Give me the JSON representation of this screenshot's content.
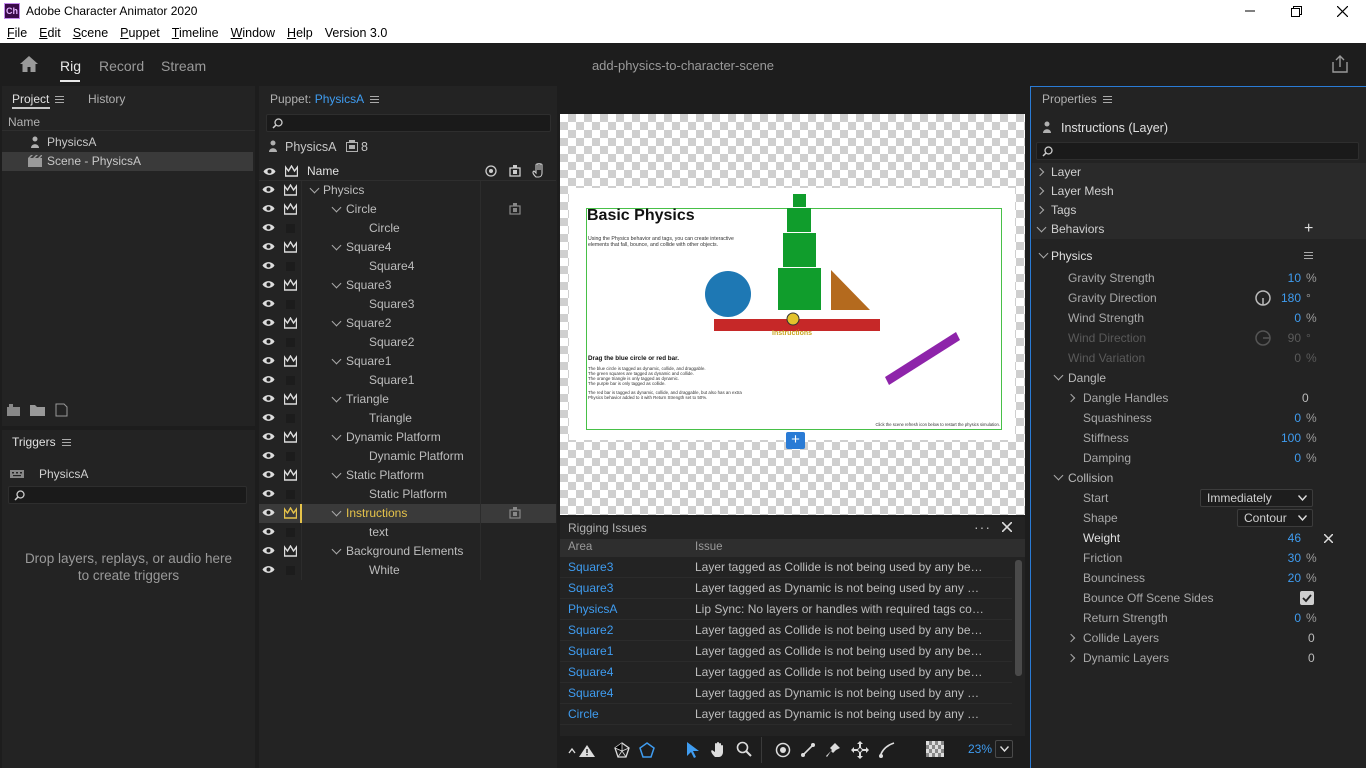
{
  "app": {
    "title": "Adobe Character Animator 2020",
    "logo": "Ch"
  },
  "menu": [
    "File",
    "Edit",
    "Scene",
    "Puppet",
    "Timeline",
    "Window",
    "Help",
    "Version 3.0"
  ],
  "menu_mnemonics": [
    "F",
    "E",
    "S",
    "P",
    "T",
    "W",
    "H",
    ""
  ],
  "workspace": {
    "tabs": [
      "Rig",
      "Record",
      "Stream"
    ],
    "active": "Rig",
    "document_title": "add-physics-to-character-scene"
  },
  "project": {
    "tabs": [
      "Project",
      "History"
    ],
    "column": "Name",
    "items": [
      "PhysicsA",
      "Scene - PhysicsA"
    ]
  },
  "triggers": {
    "title": "Triggers",
    "puppet": "PhysicsA",
    "empty_text_1": "Drop layers, replays, or audio here",
    "empty_text_2": "to create triggers"
  },
  "puppet_panel": {
    "title_prefix": "Puppet:",
    "title_name": "PhysicsA",
    "summary_name": "PhysicsA",
    "summary_count": "8",
    "column_name": "Name",
    "rows": [
      {
        "label": "Physics",
        "level": 0,
        "group": true,
        "crown": true
      },
      {
        "label": "Circle",
        "level": 1,
        "group": true,
        "crown": true,
        "lock": true
      },
      {
        "label": "Circle",
        "level": 2,
        "group": false,
        "crown": false
      },
      {
        "label": "Square4",
        "level": 1,
        "group": true,
        "crown": true
      },
      {
        "label": "Square4",
        "level": 2,
        "group": false,
        "crown": false
      },
      {
        "label": "Square3",
        "level": 1,
        "group": true,
        "crown": true
      },
      {
        "label": "Square3",
        "level": 2,
        "group": false,
        "crown": false
      },
      {
        "label": "Square2",
        "level": 1,
        "group": true,
        "crown": true
      },
      {
        "label": "Square2",
        "level": 2,
        "group": false,
        "crown": false
      },
      {
        "label": "Square1",
        "level": 1,
        "group": true,
        "crown": true
      },
      {
        "label": "Square1",
        "level": 2,
        "group": false,
        "crown": false
      },
      {
        "label": "Triangle",
        "level": 1,
        "group": true,
        "crown": true
      },
      {
        "label": "Triangle",
        "level": 2,
        "group": false,
        "crown": false
      },
      {
        "label": "Dynamic Platform",
        "level": 1,
        "group": true,
        "crown": true
      },
      {
        "label": "Dynamic Platform",
        "level": 2,
        "group": false,
        "crown": false
      },
      {
        "label": "Static Platform",
        "level": 1,
        "group": true,
        "crown": true
      },
      {
        "label": "Static Platform",
        "level": 2,
        "group": false,
        "crown": false
      },
      {
        "label": "Instructions",
        "level": 1,
        "group": true,
        "crown": true,
        "selected": true,
        "lock": true
      },
      {
        "label": "text",
        "level": 2,
        "group": false,
        "crown": false
      },
      {
        "label": "Background Elements",
        "level": 1,
        "group": true,
        "crown": true
      },
      {
        "label": "White",
        "level": 2,
        "group": false,
        "crown": false
      }
    ]
  },
  "scene": {
    "title": "Basic Physics",
    "intro": "Using the Physics behavior and tags, you can create interactive elements that fall, bounce, and collide with other objects.",
    "drag_heading": "Drag the blue circle or red bar.",
    "notes": [
      "The blue circle is tagged as dynamic, collide, and draggable.",
      "The green squares are tagged as dynamic and collide.",
      "The orange triangle is only tagged as dynamic.",
      "The purple bar is only tagged as collide."
    ],
    "note2": "The red bar is tagged as dynamic, collide, and draggable, but also has an extra Physics behavior added to it with Return Strength set to 50%.",
    "footer": "Click the scene refresh icon below to restart the physics simulation.",
    "handle_label": "Instructions"
  },
  "rigging_issues": {
    "title": "Rigging Issues",
    "columns": [
      "Area",
      "Issue"
    ],
    "rows": [
      {
        "area": "Square3",
        "issue": "Layer tagged as Collide is not being used by any behavior"
      },
      {
        "area": "Square3",
        "issue": "Layer tagged as Dynamic is not being used by any behavior"
      },
      {
        "area": "PhysicsA",
        "issue": "Lip Sync: No layers or handles with required tags could be found"
      },
      {
        "area": "Square2",
        "issue": "Layer tagged as Collide is not being used by any behavior"
      },
      {
        "area": "Square1",
        "issue": "Layer tagged as Collide is not being used by any behavior"
      },
      {
        "area": "Square4",
        "issue": "Layer tagged as Collide is not being used by any behavior"
      },
      {
        "area": "Square4",
        "issue": "Layer tagged as Dynamic is not being used by any behavior"
      },
      {
        "area": "Circle",
        "issue": "Layer tagged as Dynamic is not being used by any behavior"
      }
    ]
  },
  "toolbar": {
    "zoom": "23%"
  },
  "properties": {
    "title": "Properties",
    "layer_title": "Instructions (Layer)",
    "sections": [
      "Layer",
      "Layer Mesh",
      "Tags",
      "Behaviors"
    ],
    "physics_label": "Physics",
    "params": [
      {
        "label": "Gravity Strength",
        "value": "10",
        "unit": "%"
      },
      {
        "label": "Gravity Direction",
        "value": "180",
        "unit": "°"
      },
      {
        "label": "Wind Strength",
        "value": "0",
        "unit": "%"
      },
      {
        "label": "Wind Direction",
        "value": "90",
        "unit": "°",
        "disabled": true
      },
      {
        "label": "Wind Variation",
        "value": "0",
        "unit": "%",
        "disabled": true
      }
    ],
    "dangle_label": "Dangle",
    "dangle": [
      {
        "label": "Dangle Handles",
        "value": "0",
        "unit": ""
      },
      {
        "label": "Squashiness",
        "value": "0",
        "unit": "%"
      },
      {
        "label": "Stiffness",
        "value": "100",
        "unit": "%"
      },
      {
        "label": "Damping",
        "value": "0",
        "unit": "%"
      }
    ],
    "collision_label": "Collision",
    "start_label": "Start",
    "start_value": "Immediately",
    "shape_label": "Shape",
    "shape_value": "Contour",
    "weight_label": "Weight",
    "weight_value": "46",
    "friction_label": "Friction",
    "friction_value": "30",
    "friction_unit": "%",
    "bounciness_label": "Bounciness",
    "bounciness_value": "20",
    "bounciness_unit": "%",
    "bounce_sides_label": "Bounce Off Scene Sides",
    "return_label": "Return Strength",
    "return_value": "0",
    "return_unit": "%",
    "collide_layers_label": "Collide Layers",
    "collide_layers_value": "0",
    "dynamic_layers_label": "Dynamic Layers",
    "dynamic_layers_value": "0"
  },
  "colors": {
    "accent": "#3f9cf0",
    "selected_label": "#e6c34a",
    "panel": "#232323",
    "bg": "#1d1d1d"
  }
}
